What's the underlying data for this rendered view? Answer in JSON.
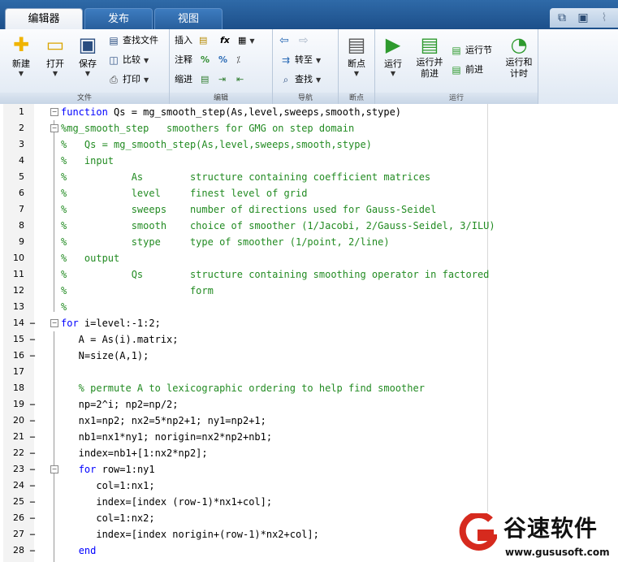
{
  "tabs": [
    {
      "label": "编辑器",
      "active": true
    },
    {
      "label": "发布",
      "active": false
    },
    {
      "label": "视图",
      "active": false
    }
  ],
  "quick_access": [
    "pin-icon",
    "save-icon",
    "broom-icon"
  ],
  "ribbon": {
    "file": {
      "label": "文件",
      "new": "新建",
      "open": "打开",
      "save": "保存",
      "find_files": "查找文件",
      "compare": "比较",
      "print": "打印"
    },
    "edit": {
      "label": "编辑",
      "insert": "插入",
      "comment": "注释",
      "indent": "缩进"
    },
    "navigate": {
      "label": "导航",
      "goto": "转至",
      "find": "查找"
    },
    "breakpoints": {
      "label": "断点",
      "breakpoints": "断点"
    },
    "run": {
      "label": "运行",
      "run": "运行",
      "run_and_advance": [
        "运行并",
        "前进"
      ],
      "run_section": "运行节",
      "advance": "前进",
      "run_and_time": [
        "运行和",
        "计时"
      ]
    }
  },
  "code_lines": [
    {
      "n": "1",
      "mark": "",
      "fold": "−",
      "segments": [
        {
          "t": "kw",
          "v": "function"
        },
        {
          "t": "tx",
          "v": " Qs = mg_smooth_step(As,level,sweeps,smooth,stype)"
        }
      ]
    },
    {
      "n": "2",
      "mark": "",
      "fold": "−",
      "segments": [
        {
          "t": "cm",
          "v": "%mg_smooth_step   smoothers for GMG on step domain"
        }
      ]
    },
    {
      "n": "3",
      "mark": "",
      "fold": "",
      "segments": [
        {
          "t": "cm",
          "v": "%   Qs = mg_smooth_step(As,level,sweeps,smooth,stype)"
        }
      ]
    },
    {
      "n": "4",
      "mark": "",
      "fold": "",
      "segments": [
        {
          "t": "cm",
          "v": "%   input"
        }
      ]
    },
    {
      "n": "5",
      "mark": "",
      "fold": "",
      "segments": [
        {
          "t": "cm",
          "v": "%           As        structure containing coefficient matrices"
        }
      ]
    },
    {
      "n": "6",
      "mark": "",
      "fold": "",
      "segments": [
        {
          "t": "cm",
          "v": "%           level     finest level of grid"
        }
      ]
    },
    {
      "n": "7",
      "mark": "",
      "fold": "",
      "segments": [
        {
          "t": "cm",
          "v": "%           sweeps    number of directions used for Gauss-Seidel"
        }
      ]
    },
    {
      "n": "8",
      "mark": "",
      "fold": "",
      "segments": [
        {
          "t": "cm",
          "v": "%           smooth    choice of smoother (1/Jacobi, 2/Gauss-Seidel, 3/ILU)"
        }
      ]
    },
    {
      "n": "9",
      "mark": "",
      "fold": "",
      "segments": [
        {
          "t": "cm",
          "v": "%           stype     type of smoother (1/point, 2/line)"
        }
      ]
    },
    {
      "n": "10",
      "mark": "",
      "fold": "",
      "segments": [
        {
          "t": "cm",
          "v": "%   output"
        }
      ]
    },
    {
      "n": "11",
      "mark": "",
      "fold": "",
      "segments": [
        {
          "t": "cm",
          "v": "%           Qs        structure containing smoothing operator in factored"
        }
      ]
    },
    {
      "n": "12",
      "mark": "",
      "fold": "",
      "segments": [
        {
          "t": "cm",
          "v": "%                     form"
        }
      ]
    },
    {
      "n": "13",
      "mark": "",
      "fold": "",
      "segments": [
        {
          "t": "cm",
          "v": "%"
        }
      ]
    },
    {
      "n": "14",
      "mark": "−",
      "fold": "−",
      "segments": [
        {
          "t": "kw",
          "v": "for"
        },
        {
          "t": "tx",
          "v": " i=level:-1:2;"
        }
      ]
    },
    {
      "n": "15",
      "mark": "−",
      "fold": "",
      "segments": [
        {
          "t": "tx",
          "v": "   A = As(i).matrix;"
        }
      ]
    },
    {
      "n": "16",
      "mark": "−",
      "fold": "",
      "segments": [
        {
          "t": "tx",
          "v": "   N=size(A,1);"
        }
      ]
    },
    {
      "n": "17",
      "mark": "",
      "fold": "",
      "segments": [
        {
          "t": "tx",
          "v": ""
        }
      ]
    },
    {
      "n": "18",
      "mark": "",
      "fold": "",
      "segments": [
        {
          "t": "cm",
          "v": "   % permute A to lexicographic ordering to help find smoother"
        }
      ]
    },
    {
      "n": "19",
      "mark": "−",
      "fold": "",
      "segments": [
        {
          "t": "tx",
          "v": "   np=2^i; np2=np/2;"
        }
      ]
    },
    {
      "n": "20",
      "mark": "−",
      "fold": "",
      "segments": [
        {
          "t": "tx",
          "v": "   nx1=np2; nx2=5*np2+1; ny1=np2+1;"
        }
      ]
    },
    {
      "n": "21",
      "mark": "−",
      "fold": "",
      "segments": [
        {
          "t": "tx",
          "v": "   nb1=nx1*ny1; norigin=nx2*np2+nb1;"
        }
      ]
    },
    {
      "n": "22",
      "mark": "−",
      "fold": "",
      "segments": [
        {
          "t": "tx",
          "v": "   index=nb1+[1:nx2*np2];"
        }
      ]
    },
    {
      "n": "23",
      "mark": "−",
      "fold": "−",
      "segments": [
        {
          "t": "tx",
          "v": "   "
        },
        {
          "t": "kw",
          "v": "for"
        },
        {
          "t": "tx",
          "v": " row=1:ny1"
        }
      ]
    },
    {
      "n": "24",
      "mark": "−",
      "fold": "",
      "segments": [
        {
          "t": "tx",
          "v": "      col=1:nx1;"
        }
      ]
    },
    {
      "n": "25",
      "mark": "−",
      "fold": "",
      "segments": [
        {
          "t": "tx",
          "v": "      index=[index (row-1)*nx1+col];"
        }
      ]
    },
    {
      "n": "26",
      "mark": "−",
      "fold": "",
      "segments": [
        {
          "t": "tx",
          "v": "      col=1:nx2;"
        }
      ]
    },
    {
      "n": "27",
      "mark": "−",
      "fold": "",
      "segments": [
        {
          "t": "tx",
          "v": "      index=[index norigin+(row-1)*nx2+col];"
        }
      ]
    },
    {
      "n": "28",
      "mark": "−",
      "fold": "",
      "segments": [
        {
          "t": "tx",
          "v": "   "
        },
        {
          "t": "kw",
          "v": "end"
        }
      ]
    }
  ],
  "watermark": {
    "name": "谷速软件",
    "url": "www.gususoft.com"
  },
  "colors": {
    "keyword": "#0000ff",
    "comment": "#228b22",
    "tab_bar": "#2f6aa8",
    "logo_red": "#d62a1e"
  }
}
